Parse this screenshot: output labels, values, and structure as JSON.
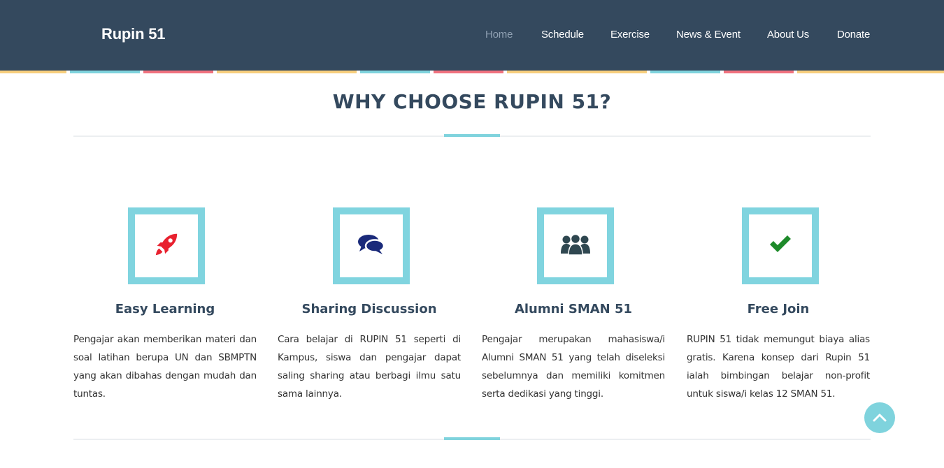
{
  "header": {
    "brand": "Rupin 51",
    "nav": [
      {
        "label": "Home",
        "active": true
      },
      {
        "label": "Schedule",
        "active": false
      },
      {
        "label": "Exercise",
        "active": false
      },
      {
        "label": "News & Event",
        "active": false
      },
      {
        "label": "About Us",
        "active": false
      },
      {
        "label": "Donate",
        "active": false
      }
    ]
  },
  "stripe_colors": [
    "#f7ce7d",
    "#7fd3dd",
    "#f0727f"
  ],
  "section": {
    "title": "WHY CHOOSE RUPIN 51?"
  },
  "features": [
    {
      "icon": "rocket-icon",
      "icon_color": "#e8212f",
      "title": "Easy Learning",
      "description": "Pengajar akan memberikan materi dan soal latihan berupa UN dan SBMPTN yang akan dibahas dengan mudah dan tuntas."
    },
    {
      "icon": "comments-icon",
      "icon_color": "#1a2a7a",
      "title": "Sharing Discussion",
      "description": "Cara belajar di RUPIN 51 seperti di Kampus, siswa dan pengajar dapat saling sharing atau berbagi ilmu satu sama lainnya."
    },
    {
      "icon": "group-icon",
      "icon_color": "#2f4750",
      "title": "Alumni SMAN 51",
      "description": "Pengajar merupakan mahasiswa/i Alumni SMAN 51 yang telah diseleksi sebelumnya dan memiliki komitmen serta dedikasi yang tinggi."
    },
    {
      "icon": "check-icon",
      "icon_color": "#1e8a2a",
      "title": "Free Join",
      "description": "RUPIN 51 tidak memungut biaya alias gratis. Karena konsep dari Rupin 51 ialah bimbingan belajar non-profit untuk siswa/i kelas 12 SMAN 51."
    }
  ],
  "scroll_top": {
    "icon": "chevron-up-icon"
  },
  "colors": {
    "header_bg": "#34495e",
    "accent": "#7fd3dd",
    "title": "#34495e"
  }
}
